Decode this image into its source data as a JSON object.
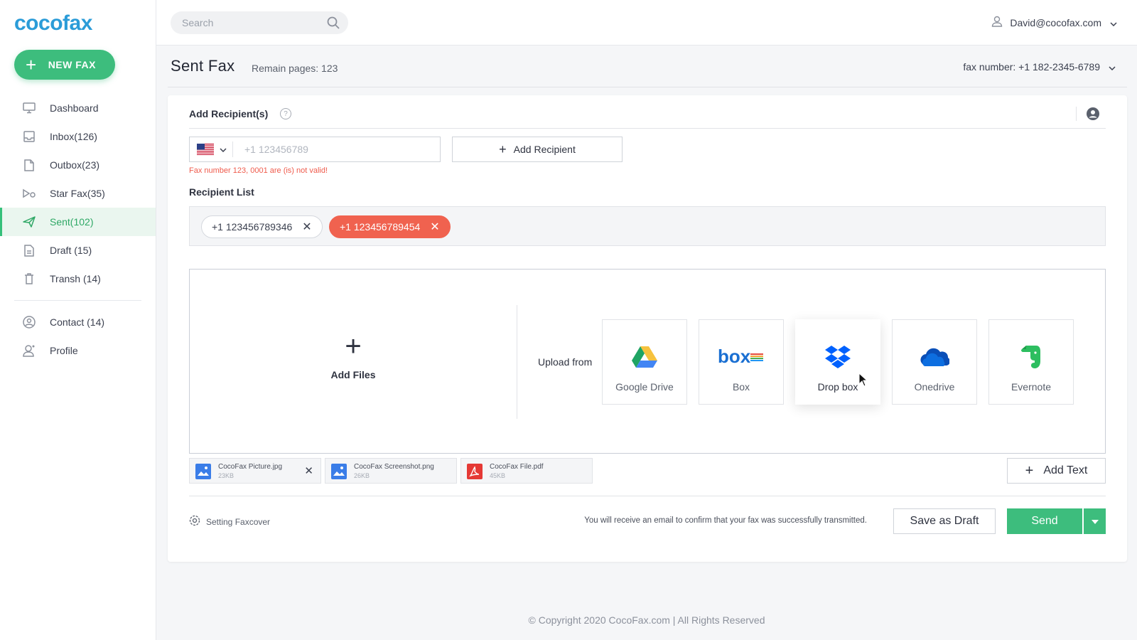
{
  "app": {
    "logo": "cocofax"
  },
  "sidebar": {
    "new_fax": "NEW FAX",
    "items": [
      {
        "label": "Dashboard",
        "icon": "monitor-icon"
      },
      {
        "label": "Inbox(126)",
        "icon": "inbox-icon"
      },
      {
        "label": "Outbox(23)",
        "icon": "document-icon"
      },
      {
        "label": "Star Fax(35)",
        "icon": "star-fax-icon"
      },
      {
        "label": "Sent(102)",
        "icon": "paper-plane-icon",
        "active": true
      },
      {
        "label": "Draft (15)",
        "icon": "draft-icon"
      },
      {
        "label": "Transh (14)",
        "icon": "trash-icon"
      },
      {
        "label": "Contact (14)",
        "icon": "contact-icon"
      },
      {
        "label": "Profile",
        "icon": "profile-icon"
      }
    ]
  },
  "topbar": {
    "search_placeholder": "Search",
    "user": "David@cocofax.com"
  },
  "header": {
    "title": "Sent Fax",
    "remain": "Remain pages: 123",
    "fax_number": "fax number: +1 182-2345-6789"
  },
  "recipients": {
    "label": "Add Recipient(s)",
    "help": "?",
    "phone_placeholder": "+1 123456789",
    "add_button": "Add Recipient",
    "error": "Fax number 123, 0001 are (is) not valid!",
    "list_label": "Recipient List",
    "chips": [
      "+1 123456789346",
      "+1 123456789454"
    ]
  },
  "upload": {
    "add_files": "Add Files",
    "upload_from": "Upload from",
    "services": [
      "Google Drive",
      "Box",
      "Drop box",
      "Onedrive",
      "Evernote"
    ]
  },
  "files": [
    {
      "name": "CocoFax Picture.jpg",
      "size": "23KB",
      "type": "image"
    },
    {
      "name": "CocoFax Screenshot.png",
      "size": "26KB",
      "type": "image"
    },
    {
      "name": "CocoFax File.pdf",
      "size": "45KB",
      "type": "pdf"
    }
  ],
  "actions": {
    "add_text": "Add Text",
    "faxcover": "Setting Faxcover",
    "note": "You will receive an email to confirm that your fax was successfully transmitted.",
    "save_draft": "Save as Draft",
    "send": "Send"
  },
  "footer": "© Copyright 2020 CocoFax.com | All Rights Reserved",
  "colors": {
    "accent": "#3dbd7d",
    "brand_blue": "#2b9cd8",
    "danger": "#f0624f"
  }
}
